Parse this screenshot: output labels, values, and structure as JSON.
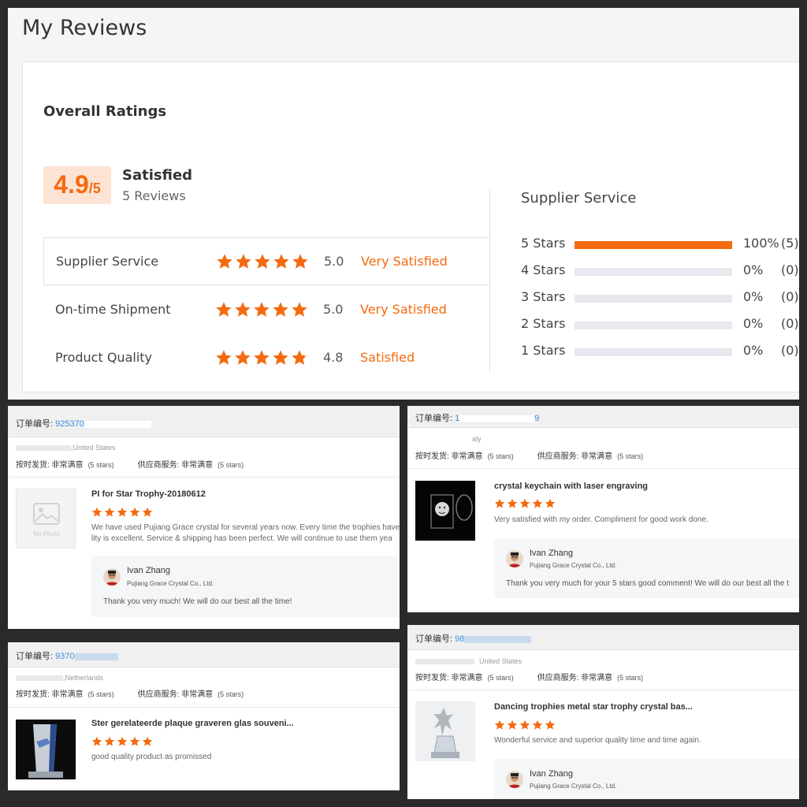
{
  "page": {
    "title": "My Reviews"
  },
  "overall": {
    "heading": "Overall Ratings",
    "score": "4.9",
    "score_of": "/5",
    "label": "Satisfied",
    "reviews": "5 Reviews",
    "rows": [
      {
        "label": "Supplier Service",
        "score": "5.0",
        "text": "Very Satisfied",
        "stars": 5
      },
      {
        "label": "On-time Shipment",
        "score": "5.0",
        "text": "Very Satisfied",
        "stars": 5
      },
      {
        "label": "Product Quality",
        "score": "4.8",
        "text": "Satisfied",
        "stars": 4.8
      }
    ]
  },
  "supplier_service": {
    "title": "Supplier Service",
    "rows": [
      {
        "label": "5  Stars",
        "pct": "100%",
        "count": "(5)",
        "fraction": 1
      },
      {
        "label": "4  Stars",
        "pct": "0%",
        "count": "(0)",
        "fraction": 0
      },
      {
        "label": "3  Stars",
        "pct": "0%",
        "count": "(0)",
        "fraction": 0
      },
      {
        "label": "2  Stars",
        "pct": "0%",
        "count": "(0)",
        "fraction": 0
      },
      {
        "label": "1  Stars",
        "pct": "0%",
        "count": "(0)",
        "fraction": 0
      }
    ]
  },
  "labels": {
    "order_no": "订单编号: ",
    "ontime": "按时发货: 非常满意",
    "supplier": "供应商服务: 非常满意",
    "five_stars": "(5 stars)"
  },
  "reviews": [
    {
      "order_no": "925370",
      "buyer": ",United States",
      "title": "PI for Star Trophy-20180612",
      "text_line1": "We have used Pujiang Grace crystal for several years now. Every time the trophies have",
      "text_line2": "lity is excellent. Service & shipping has been perfect. We will continue to use them yea",
      "thumb_label": "No Photo",
      "reply": {
        "name": "Ivan Zhang",
        "company": "Pujiang Grace Crystal Co., Ltd.",
        "text": "Thank you very much! We will do our best all the time!"
      }
    },
    {
      "order_no": "1",
      "order_no_tail": "9",
      "buyer": "aly",
      "title": "crystal keychain with laser engraving",
      "text_line1": "Very satisfied with my order. Compliment for good work done.",
      "reply": {
        "name": "Ivan Zhang",
        "company": "Pujiang Grace Crystal Co., Ltd.",
        "text": "Thank you very much for your 5 stars good comment! We will do our best all the t"
      }
    },
    {
      "order_no": "9370",
      "buyer": ",Netherlands",
      "title": "Ster gerelateerde plaque graveren glas souveni...",
      "text_line1": "good quality product as promissed"
    },
    {
      "order_no": "98",
      "buyer": "United States",
      "title": "Dancing trophies metal star trophy crystal bas...",
      "text_line1": "Wonderful service and superior quality time and time again.",
      "reply": {
        "name": "Ivan Zhang",
        "company": "Pujiang Grace Crystal Co., Ltd."
      }
    }
  ],
  "colors": {
    "accent": "#f46a10",
    "link": "#3a8ee6"
  }
}
